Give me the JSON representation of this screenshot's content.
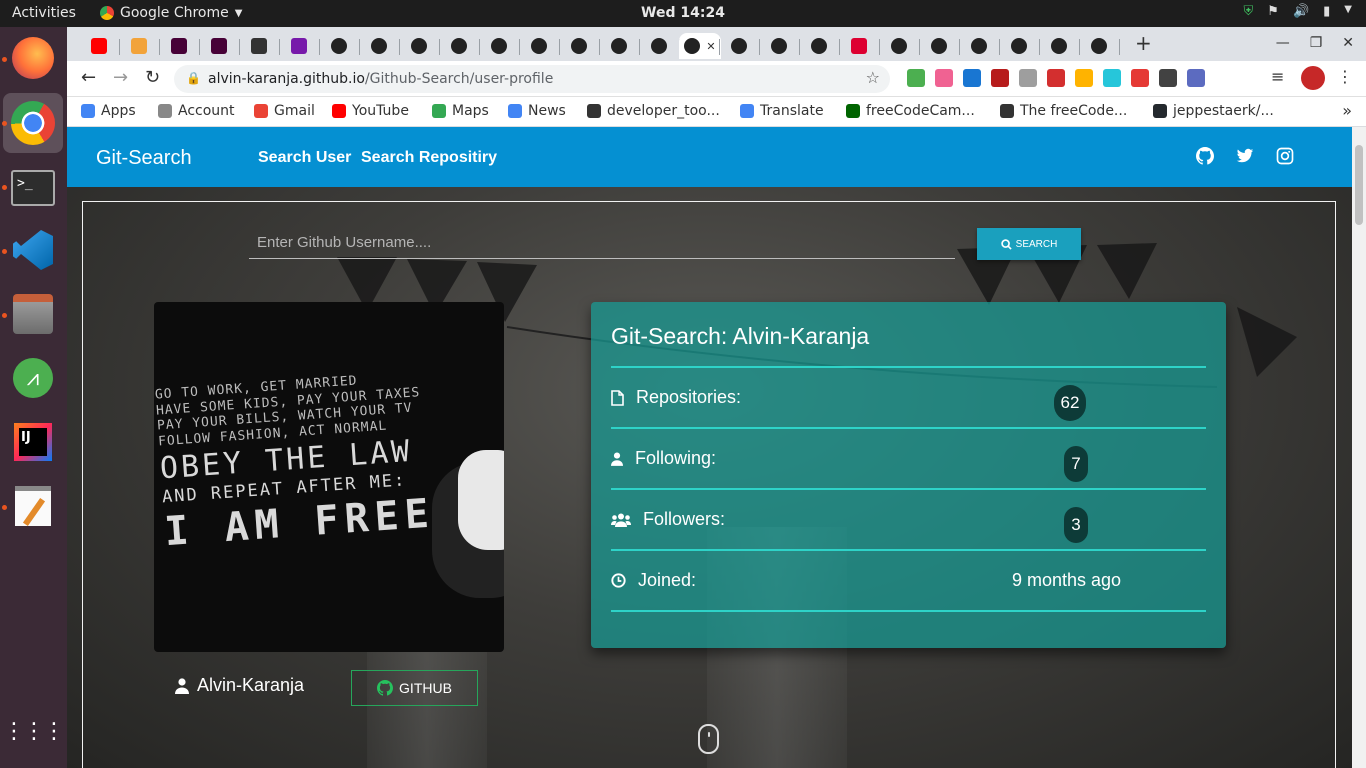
{
  "system_bar": {
    "activities": "Activities",
    "app_name": "Google Chrome",
    "clock": "Wed 14:24"
  },
  "browser": {
    "url_host": "alvin-karanja.github.io",
    "url_path": "/Github-Search/user-profile",
    "bookmarks": [
      {
        "label": "Apps",
        "icon": "apps-grid-icon",
        "color": "#4285f4"
      },
      {
        "label": "Account",
        "icon": "account-icon",
        "color": "#888888"
      },
      {
        "label": "Gmail",
        "icon": "gmail-icon",
        "color": "#ea4335"
      },
      {
        "label": "YouTube",
        "icon": "youtube-icon",
        "color": "#ff0000"
      },
      {
        "label": "Maps",
        "icon": "maps-icon",
        "color": "#34a853"
      },
      {
        "label": "News",
        "icon": "news-icon",
        "color": "#4285f4"
      },
      {
        "label": "developer_too...",
        "icon": "globe-icon",
        "color": "#333333"
      },
      {
        "label": "Translate",
        "icon": "translate-icon",
        "color": "#4285f4"
      },
      {
        "label": "freeCodeCam...",
        "icon": "freecodecamp-icon",
        "color": "#006400"
      },
      {
        "label": "The freeCode...",
        "icon": "globe-icon",
        "color": "#333333"
      },
      {
        "label": "jeppestaerk/...",
        "icon": "github-icon",
        "color": "#24292e"
      }
    ]
  },
  "site": {
    "brand": "Git-Search",
    "nav": {
      "search_user": "Search User",
      "search_repo": "Search Repositiry"
    },
    "search": {
      "placeholder": "Enter Github Username....",
      "button_label": "SEARCH"
    },
    "profile": {
      "username": "Alvin-Karanja",
      "github_button": "GITHUB",
      "avatar_quote": {
        "line1": "GO TO WORK, GET MARRIED",
        "line2": "HAVE SOME KIDS, PAY YOUR TAXES",
        "line3": "PAY YOUR BILLS, WATCH YOUR TV",
        "line4": "FOLLOW FASHION, ACT NORMAL",
        "line5": "OBEY THE LAW",
        "line6": "AND REPEAT AFTER ME:",
        "line7": "I AM FREE"
      }
    },
    "card": {
      "title": "Git-Search: Alvin-Karanja",
      "repositories_label": "Repositories:",
      "repositories_value": "62",
      "following_label": "Following:",
      "following_value": "7",
      "followers_label": "Followers:",
      "followers_value": "3",
      "joined_label": "Joined:",
      "joined_value": "9 months ago"
    },
    "colors": {
      "navbar": "#0590d2",
      "search_button": "#1aa0be",
      "card": "#169b94",
      "github_border": "#26a65b"
    }
  }
}
